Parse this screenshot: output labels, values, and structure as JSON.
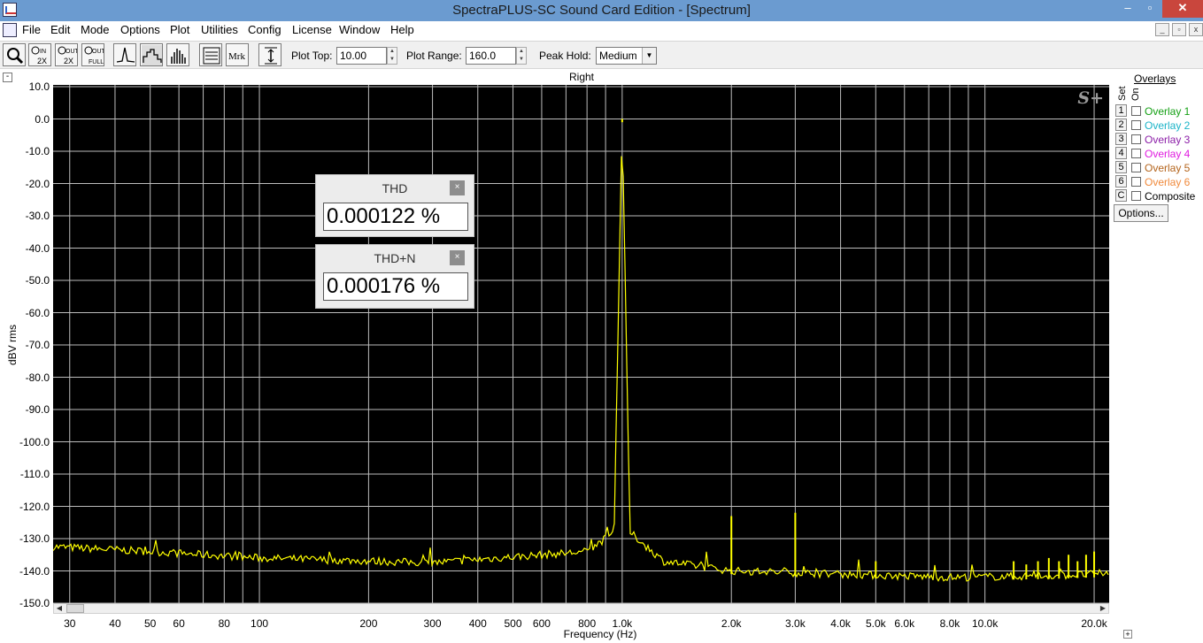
{
  "window": {
    "title": "SpectraPLUS-SC Sound Card Edition - [Spectrum]"
  },
  "window_controls": {
    "min": "–",
    "max": "▫",
    "close": "✕"
  },
  "menu": [
    "File",
    "Edit",
    "Mode",
    "Options",
    "Plot",
    "Utilities",
    "Config",
    "License",
    "Window",
    "Help"
  ],
  "toolbar": {
    "plot_top_label": "Plot Top:",
    "plot_top_value": "10.00",
    "plot_range_label": "Plot Range:",
    "plot_range_value": "160.0",
    "peak_hold_label": "Peak Hold:",
    "peak_hold_value": "Medium",
    "buttons": [
      "zoom-icon",
      "zoom-in-2x-icon",
      "zoom-out-2x-icon",
      "zoom-out-full-icon",
      "line-plot-icon",
      "step-plot-icon",
      "bar-plot-icon",
      "display-settings-icon",
      "marker-icon",
      "autoscale-icon"
    ],
    "marker_button_label": "Mrk"
  },
  "meters": [
    {
      "name": "THD",
      "value": "0.000122 %"
    },
    {
      "name": "THD+N",
      "value": "0.000176 %"
    }
  ],
  "overlays": {
    "title": "Overlays",
    "set_header": "Set",
    "on_header": "On",
    "items": [
      {
        "set": "1",
        "label": "Overlay 1",
        "color": "#14a014",
        "checked": false
      },
      {
        "set": "2",
        "label": "Overlay 2",
        "color": "#1cb4c8",
        "checked": false
      },
      {
        "set": "3",
        "label": "Overlay 3",
        "color": "#8c1fa8",
        "checked": false
      },
      {
        "set": "4",
        "label": "Overlay 4",
        "color": "#e01ce0",
        "checked": false
      },
      {
        "set": "5",
        "label": "Overlay 5",
        "color": "#b4641c",
        "checked": false
      },
      {
        "set": "6",
        "label": "Overlay 6",
        "color": "#f08a3c",
        "checked": false
      },
      {
        "set": "C",
        "label": "Composite",
        "color": "#000000",
        "checked": false
      }
    ],
    "options_button": "Options..."
  },
  "chart_data": {
    "type": "line",
    "title": "Right",
    "xlabel": "Frequency (Hz)",
    "ylabel": "dBV rms",
    "x_scale": "log",
    "xlim": [
      27,
      22000
    ],
    "ylim": [
      -150,
      10
    ],
    "xticks": [
      {
        "v": 30,
        "label": "30"
      },
      {
        "v": 40,
        "label": "40"
      },
      {
        "v": 50,
        "label": "50"
      },
      {
        "v": 60,
        "label": "60"
      },
      {
        "v": 80,
        "label": "80"
      },
      {
        "v": 100,
        "label": "100"
      },
      {
        "v": 200,
        "label": "200"
      },
      {
        "v": 300,
        "label": "300"
      },
      {
        "v": 400,
        "label": "400"
      },
      {
        "v": 500,
        "label": "500"
      },
      {
        "v": 600,
        "label": "600"
      },
      {
        "v": 800,
        "label": "800"
      },
      {
        "v": 1000,
        "label": "1.0k"
      },
      {
        "v": 2000,
        "label": "2.0k"
      },
      {
        "v": 3000,
        "label": "3.0k"
      },
      {
        "v": 4000,
        "label": "4.0k"
      },
      {
        "v": 5000,
        "label": "5.0k"
      },
      {
        "v": 6000,
        "label": "6.0k"
      },
      {
        "v": 8000,
        "label": "8.0k"
      },
      {
        "v": 10000,
        "label": "10.0k"
      },
      {
        "v": 20000,
        "label": "20.0k"
      }
    ],
    "yticks": [
      {
        "v": 10,
        "label": "10.0"
      },
      {
        "v": 0,
        "label": "0.0"
      },
      {
        "v": -10,
        "label": "-10.0"
      },
      {
        "v": -20,
        "label": "-20.0"
      },
      {
        "v": -30,
        "label": "-30.0"
      },
      {
        "v": -40,
        "label": "-40.0"
      },
      {
        "v": -50,
        "label": "-50.0"
      },
      {
        "v": -60,
        "label": "-60.0"
      },
      {
        "v": -70,
        "label": "-70.0"
      },
      {
        "v": -80,
        "label": "-80.0"
      },
      {
        "v": -90,
        "label": "-90.0"
      },
      {
        "v": -100,
        "label": "-100.0"
      },
      {
        "v": -110,
        "label": "-110.0"
      },
      {
        "v": -120,
        "label": "-120.0"
      },
      {
        "v": -130,
        "label": "-130.0"
      },
      {
        "v": -140,
        "label": "-140.0"
      },
      {
        "v": -150,
        "label": "-150.0"
      }
    ],
    "grid": true,
    "series_color": "#ffff00",
    "noise_floor": [
      [
        27,
        -132.5
      ],
      [
        50,
        -134
      ],
      [
        100,
        -136
      ],
      [
        300,
        -137.5
      ],
      [
        800,
        -134
      ],
      [
        950,
        -128
      ],
      [
        1000,
        0
      ],
      [
        1050,
        -128
      ],
      [
        1300,
        -137
      ],
      [
        2000,
        -140
      ],
      [
        4000,
        -141
      ],
      [
        8000,
        -142
      ],
      [
        15000,
        -141.5
      ],
      [
        20000,
        -141
      ],
      [
        22000,
        -140.5
      ]
    ],
    "peaks": [
      {
        "x": 1000,
        "y": 0
      },
      {
        "x": 2000,
        "y": -123
      },
      {
        "x": 3000,
        "y": -122
      },
      {
        "x": 5000,
        "y": -137
      },
      {
        "x": 12000,
        "y": -137
      },
      {
        "x": 13000,
        "y": -138
      },
      {
        "x": 14000,
        "y": -137
      },
      {
        "x": 15000,
        "y": -136
      },
      {
        "x": 16000,
        "y": -137
      },
      {
        "x": 17000,
        "y": -135
      },
      {
        "x": 18000,
        "y": -137
      },
      {
        "x": 19000,
        "y": -135
      },
      {
        "x": 20000,
        "y": -134
      }
    ]
  }
}
